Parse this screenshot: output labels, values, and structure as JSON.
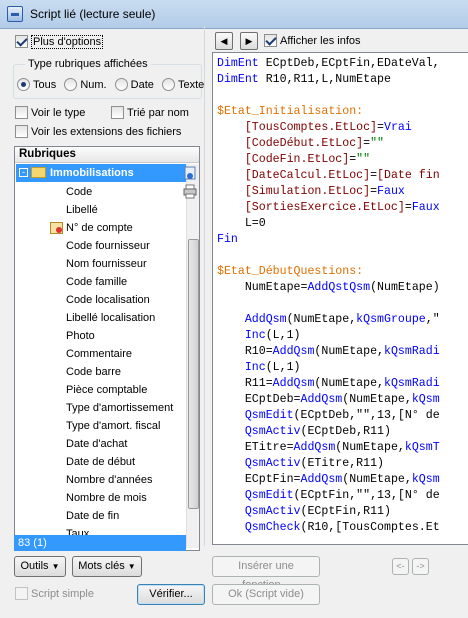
{
  "window": {
    "title": "Script lié (lecture seule)"
  },
  "left": {
    "more_options": {
      "label": "Plus d'options",
      "checked": true
    },
    "types_group": {
      "title": "Type rubriques affichées",
      "options": [
        {
          "label": "Tous",
          "selected": true
        },
        {
          "label": "Num.",
          "selected": false
        },
        {
          "label": "Date",
          "selected": false
        },
        {
          "label": "Texte",
          "selected": false
        }
      ]
    },
    "show_type": {
      "label": "Voir le type",
      "checked": false
    },
    "sort_by_name": {
      "label": "Trié par nom",
      "checked": false
    },
    "show_extensions": {
      "label": "Voir les extensions des fichiers",
      "checked": false
    },
    "tree": {
      "header": "Rubriques",
      "root": "Immobilisations",
      "items": [
        "Code",
        "Libellé",
        "N° de compte",
        "Code fournisseur",
        "Nom fournisseur",
        "Code famille",
        "Code localisation",
        "Libellé localisation",
        "Photo",
        "Commentaire",
        "Code barre",
        "Pièce comptable",
        "Type d'amortissement",
        "Type d'amort. fiscal",
        "Date d'achat",
        "Date de début",
        "Nombre d'années",
        "Nombre de mois",
        "Date de fin",
        "Taux"
      ]
    },
    "status": "83 (1)"
  },
  "toolbar": {
    "show_info": {
      "label": "Afficher les infos",
      "checked": true
    }
  },
  "editor": {
    "lines": [
      [
        {
          "t": "DimEnt",
          "c": "k"
        },
        {
          "t": " ECptDeb,ECptFin,EDateVal,",
          "c": ""
        }
      ],
      [
        {
          "t": "DimEnt",
          "c": "k"
        },
        {
          "t": " R10,R11,L,NumEtape",
          "c": ""
        }
      ],
      [],
      [
        {
          "t": "$Etat_Initialisation:",
          "c": "lbl-orange"
        }
      ],
      [
        {
          "t": "    [TousComptes.EtLoc]",
          "c": "br"
        },
        {
          "t": "=",
          "c": ""
        },
        {
          "t": "Vrai",
          "c": "k"
        }
      ],
      [
        {
          "t": "    [CodeDébut.EtLoc]",
          "c": "br"
        },
        {
          "t": "=",
          "c": ""
        },
        {
          "t": "\"\"",
          "c": "s"
        }
      ],
      [
        {
          "t": "    [CodeFin.EtLoc]",
          "c": "br"
        },
        {
          "t": "=",
          "c": ""
        },
        {
          "t": "\"\"",
          "c": "s"
        }
      ],
      [
        {
          "t": "    [DateCalcul.EtLoc]",
          "c": "br"
        },
        {
          "t": "=",
          "c": ""
        },
        {
          "t": "[Date fin",
          "c": "br"
        }
      ],
      [
        {
          "t": "    [Simulation.EtLoc]",
          "c": "br"
        },
        {
          "t": "=",
          "c": ""
        },
        {
          "t": "Faux",
          "c": "k"
        }
      ],
      [
        {
          "t": "    [SortiesExercice.EtLoc]",
          "c": "br"
        },
        {
          "t": "=",
          "c": ""
        },
        {
          "t": "Faux",
          "c": "k"
        }
      ],
      [
        {
          "t": "    L=0",
          "c": ""
        }
      ],
      [
        {
          "t": "Fin",
          "c": "k"
        }
      ],
      [],
      [
        {
          "t": "$Etat_DébutQuestions:",
          "c": "lbl-orange"
        }
      ],
      [
        {
          "t": "    NumEtape=",
          "c": ""
        },
        {
          "t": "AddQstQsm",
          "c": "k"
        },
        {
          "t": "(NumEtape)",
          "c": ""
        }
      ],
      [],
      [
        {
          "t": "    ",
          "c": ""
        },
        {
          "t": "AddQsm",
          "c": "k"
        },
        {
          "t": "(NumEtape,",
          "c": ""
        },
        {
          "t": "kQsmGroupe",
          "c": "k"
        },
        {
          "t": ",\"",
          "c": ""
        }
      ],
      [
        {
          "t": "    ",
          "c": ""
        },
        {
          "t": "Inc",
          "c": "k"
        },
        {
          "t": "(L,1)",
          "c": ""
        }
      ],
      [
        {
          "t": "    R10=",
          "c": ""
        },
        {
          "t": "AddQsm",
          "c": "k"
        },
        {
          "t": "(NumEtape,",
          "c": ""
        },
        {
          "t": "kQsmRadi",
          "c": "k"
        }
      ],
      [
        {
          "t": "    ",
          "c": ""
        },
        {
          "t": "Inc",
          "c": "k"
        },
        {
          "t": "(L,1)",
          "c": ""
        }
      ],
      [
        {
          "t": "    R11=",
          "c": ""
        },
        {
          "t": "AddQsm",
          "c": "k"
        },
        {
          "t": "(NumEtape,",
          "c": ""
        },
        {
          "t": "kQsmRadi",
          "c": "k"
        }
      ],
      [
        {
          "t": "    ECptDeb=",
          "c": ""
        },
        {
          "t": "AddQsm",
          "c": "k"
        },
        {
          "t": "(NumEtape,",
          "c": ""
        },
        {
          "t": "kQsm",
          "c": "k"
        }
      ],
      [
        {
          "t": "    ",
          "c": ""
        },
        {
          "t": "QsmEdit",
          "c": "k"
        },
        {
          "t": "(ECptDeb,\"\",13,[N° de",
          "c": ""
        }
      ],
      [
        {
          "t": "    ",
          "c": ""
        },
        {
          "t": "QsmActiv",
          "c": "k"
        },
        {
          "t": "(ECptDeb,R11)",
          "c": ""
        }
      ],
      [
        {
          "t": "    ETitre=",
          "c": ""
        },
        {
          "t": "AddQsm",
          "c": "k"
        },
        {
          "t": "(NumEtape,",
          "c": ""
        },
        {
          "t": "kQsmT",
          "c": "k"
        }
      ],
      [
        {
          "t": "    ",
          "c": ""
        },
        {
          "t": "QsmActiv",
          "c": "k"
        },
        {
          "t": "(ETitre,R11)",
          "c": ""
        }
      ],
      [
        {
          "t": "    ECptFin=",
          "c": ""
        },
        {
          "t": "AddQsm",
          "c": "k"
        },
        {
          "t": "(NumEtape,",
          "c": ""
        },
        {
          "t": "kQsm",
          "c": "k"
        }
      ],
      [
        {
          "t": "    ",
          "c": ""
        },
        {
          "t": "QsmEdit",
          "c": "k"
        },
        {
          "t": "(ECptFin,\"\",13,[N° de",
          "c": ""
        }
      ],
      [
        {
          "t": "    ",
          "c": ""
        },
        {
          "t": "QsmActiv",
          "c": "k"
        },
        {
          "t": "(ECptFin,R11)",
          "c": ""
        }
      ],
      [
        {
          "t": "    ",
          "c": ""
        },
        {
          "t": "QsmCheck",
          "c": "k"
        },
        {
          "t": "(R10,[TousComptes.Et",
          "c": ""
        }
      ]
    ]
  },
  "bottom": {
    "tools_label": "Outils",
    "keywords_label": "Mots clés",
    "insert_function_label": "Insérer une fonction...",
    "simple_script": {
      "label": "Script simple",
      "checked": false
    },
    "verify_label": "Vérifier...",
    "ok_label": "Ok (Script vide)"
  },
  "colors": {
    "selection": "#3399ff",
    "keyword": "#0000ff",
    "label": "#e07000",
    "field": "#800000",
    "string": "#008000"
  }
}
